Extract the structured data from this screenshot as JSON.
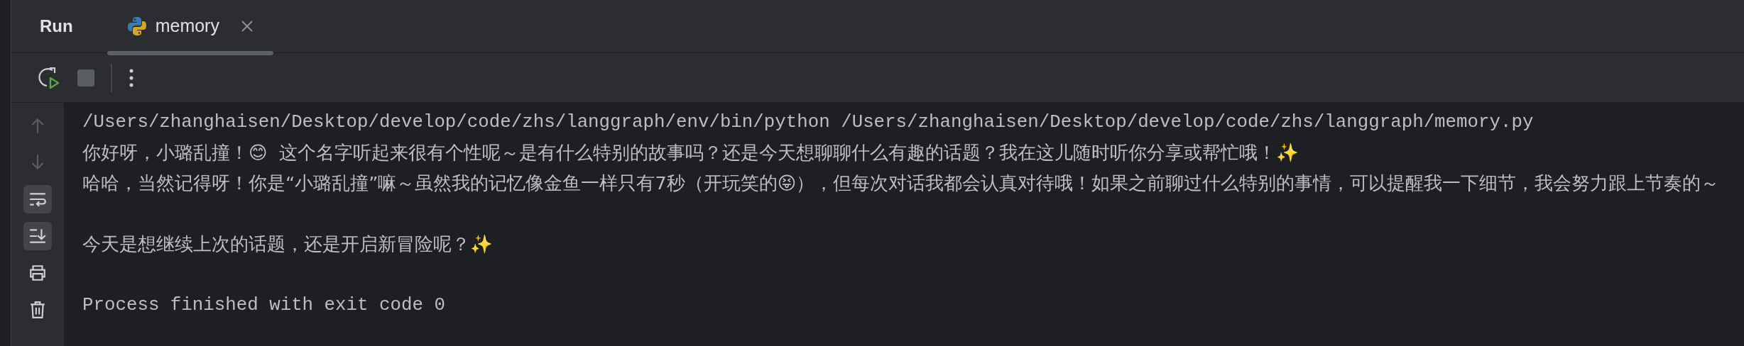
{
  "panel": {
    "title": "Run"
  },
  "tabs": [
    {
      "label": "memory",
      "selected": true,
      "closable": true
    }
  ],
  "toolbar": [
    {
      "kind": "rerun"
    },
    {
      "kind": "stop",
      "disabled": true
    },
    {
      "kind": "separator"
    },
    {
      "kind": "more"
    }
  ],
  "gutter": [
    {
      "kind": "up",
      "disabled": true,
      "on": false
    },
    {
      "kind": "down",
      "disabled": true,
      "on": false
    },
    {
      "kind": "wrap",
      "disabled": false,
      "on": true
    },
    {
      "kind": "scroll",
      "disabled": false,
      "on": true
    },
    {
      "kind": "print",
      "disabled": false,
      "on": false
    },
    {
      "kind": "trash",
      "disabled": false,
      "on": false
    }
  ],
  "console": [
    {
      "lines": [
        {
          "kind": "command",
          "text": "/Users/zhanghaisen/Desktop/develop/code/zhs/langgraph/env/bin/python /Users/zhanghaisen/Desktop/develop/code/zhs/langgraph/memory.py"
        },
        {
          "kind": "output",
          "text": "你好呀，小璐乱撞！😊  这个名字听起来很有个性呢～是有什么特别的故事吗？还是今天想聊聊什么有趣的话题？我在这儿随时听你分享或帮忙哦！✨"
        },
        {
          "kind": "output",
          "text": "哈哈，当然记得呀！你是“小璐乱撞”嘛～虽然我的记忆像金鱼一样只有7秒（开玩笑的😝），但每次对话我都会认真对待哦！如果之前聊过什么特别的事情，可以提醒我一下细节，我会努力跟上节奏的～"
        }
      ]
    },
    {
      "lines": [
        {
          "kind": "output",
          "text": "今天是想继续上次的话题，还是开启新冒险呢？✨"
        }
      ]
    },
    {
      "lines": [
        {
          "kind": "command",
          "text": "Process finished with exit code 0"
        }
      ]
    }
  ]
}
